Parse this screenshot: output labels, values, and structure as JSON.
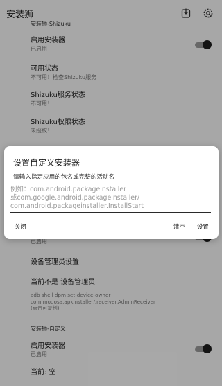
{
  "app": {
    "title": "安装狮"
  },
  "icons": {
    "install": "package-download-icon",
    "settings": "gear-icon"
  },
  "background": {
    "section_shizuku": "安装狮-Shizuku",
    "rows": [
      {
        "title": "启用安装器",
        "subtitle": "已启用"
      },
      {
        "title": "可用状态",
        "subtitle": "不可用！检查Shizuku服务"
      },
      {
        "title": "Shizuku服务状态",
        "subtitle": "不可用！"
      },
      {
        "title": "Shizuku权限状态",
        "subtitle": "未授权！"
      }
    ],
    "partial_enabled": "已启用",
    "device_admin_settings": "设备管理员设置",
    "device_admin_status": "当前不是 设备管理员",
    "adb_lines": [
      "adb shell dpm set-device-owner",
      "com.modosa.apkinstaller/.receiver.AdminReceiver",
      "(点击可复制)"
    ],
    "section_custom": "安装狮-自定义",
    "custom_enable_title": "启用安装器",
    "custom_enable_subtitle": "已启用",
    "current_label": "当前: 空"
  },
  "dialog": {
    "title": "设置自定义安装器",
    "message": "请输入指定应用的包名或完整的活动名",
    "placeholder_lines": [
      "例如：com.android.packageinstaller",
      "或com.google.android.packageinstaller/",
      "com.android.packageinstaller.InstallStart"
    ],
    "buttons": {
      "close": "关闭",
      "clear": "清空",
      "set": "设置"
    }
  }
}
